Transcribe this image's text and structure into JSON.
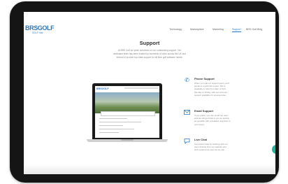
{
  "header": {
    "logo": "BRSGOLF",
    "logo_sub": "GOLF Hub",
    "nav": [
      "Technology",
      "Marketplace",
      "Marketing",
      "Support",
      "BRS Golf Blog"
    ],
    "active_nav": "Support"
  },
  "page": {
    "title": "Support",
    "intro": "At BRS Golf we pride ourselves on our outstanding support. Our dedicated team has been trusted by hundreds of clubs across the UK and Ireland to provide top class support for all their golf software needs."
  },
  "laptop": {
    "logo": "BRSGOLF"
  },
  "sections": [
    {
      "icon": "phone-icon",
      "title": "Phone Support",
      "text": "When you call our support team you'll speak to a golf club expert. We're available to help from 9am to 5pm Monday to Friday, with out-of-hours support available for emergencies."
    },
    {
      "icon": "email-icon",
      "title": "Email Support",
      "text": "If you prefer, you can email our team and we will get back to you as quickly as possible with a detailed response to your query."
    },
    {
      "icon": "chat-icon",
      "title": "Live Chat",
      "text": "Get instant help by chatting with our team directly from our website and we'll respond as soon as we can."
    }
  ],
  "colors": {
    "brand": "#2a78c0",
    "chat": "#1bb89e"
  }
}
